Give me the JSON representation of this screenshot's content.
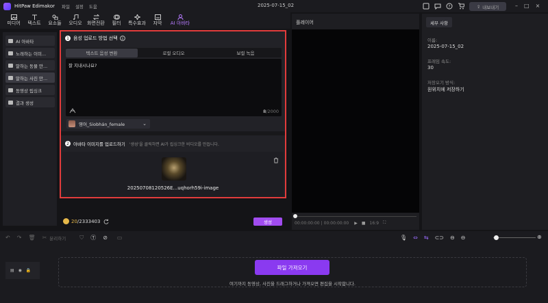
{
  "app": {
    "title": "HitPaw Edimakor",
    "menu": [
      "파일",
      "설정",
      "도움"
    ],
    "project_name": "2025-07-15_02",
    "export_label": "내보내기"
  },
  "toolbar": {
    "items": [
      {
        "label": "미디어",
        "icon": "media-icon"
      },
      {
        "label": "텍스트",
        "icon": "text-icon"
      },
      {
        "label": "요소들",
        "icon": "elements-icon"
      },
      {
        "label": "오디오",
        "icon": "audio-icon"
      },
      {
        "label": "화면전환",
        "icon": "transition-icon"
      },
      {
        "label": "필터",
        "icon": "filter-icon"
      },
      {
        "label": "특수효과",
        "icon": "effects-icon"
      },
      {
        "label": "자막",
        "icon": "subtitle-icon"
      },
      {
        "label": "AI 아바타",
        "icon": "ai-avatar-icon"
      }
    ],
    "active_index": 8
  },
  "sidebar": {
    "items": [
      "AI 아바타",
      "노래하는 이미...",
      "말하는 동물 만...",
      "말하는 사진 만...",
      "동영상 립싱크",
      "결과 생성"
    ],
    "active_index": 3
  },
  "step1": {
    "number": "1",
    "title": "음성 업로드 방법 선택",
    "tabs": [
      "텍스트 음성 변환",
      "로컬 오디오",
      "보컬 녹음"
    ],
    "active_tab": 0,
    "text_value": "잘 지내시나요?",
    "char_count": "8",
    "char_max": "/2000",
    "voice": "영어_Siobhán_female"
  },
  "step2": {
    "number": "2",
    "title": "아바타 이미지를 업로드하기",
    "hint": "'생성'을 클릭하면 AI가 립싱크한 비디오를 만듭니다.",
    "image_name": "20250708120526E...uqhorh59i-image"
  },
  "footer": {
    "credits_used": "20",
    "credits_total": "/2333403",
    "generate_label": "생성"
  },
  "player": {
    "title": "플레이어",
    "time_current": "00:00:00:00",
    "time_total": "00:00:00:00",
    "aspect": "16:9"
  },
  "details": {
    "tab": "세부 사항",
    "name_label": "이름:",
    "name_value": "2025-07-15_02",
    "fps_label": "프레임 속도:",
    "fps_value": "30",
    "save_label": "저장오기 방식:",
    "save_value": "원위치에 저장하기"
  },
  "timeline": {
    "split_label": "분리하기",
    "import_label": "파일 가져오기",
    "drop_hint": "여기까지 동영상, 사진을 드래그하거나 가져오면 편집을 시작합니다."
  }
}
